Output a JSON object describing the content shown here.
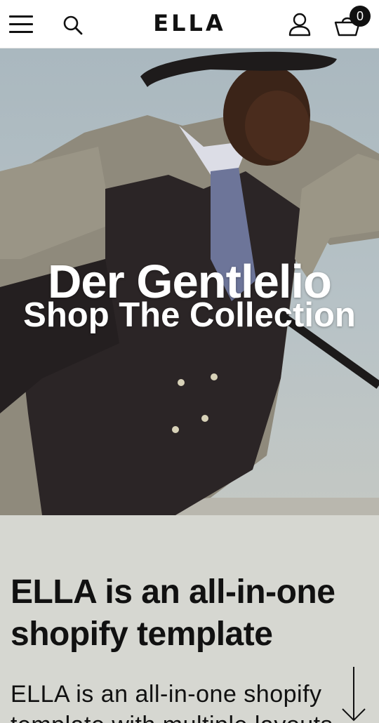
{
  "header": {
    "logo": "ELLA",
    "cart_count": "0",
    "icons": [
      "menu-icon",
      "search-icon",
      "account-icon",
      "cart-icon"
    ]
  },
  "hero": {
    "title": "Der Gentlelio",
    "link_label": "Shop The Collection"
  },
  "intro": {
    "heading": "ELLA is an all-in-one shopify template",
    "body": "ELLA is an all-in-one shopify template with multiple layouts"
  },
  "colors": {
    "header_bg": "#ffffff",
    "text": "#111111",
    "intro_bg": "#d6d7d1",
    "hero_text": "#ffffff"
  }
}
